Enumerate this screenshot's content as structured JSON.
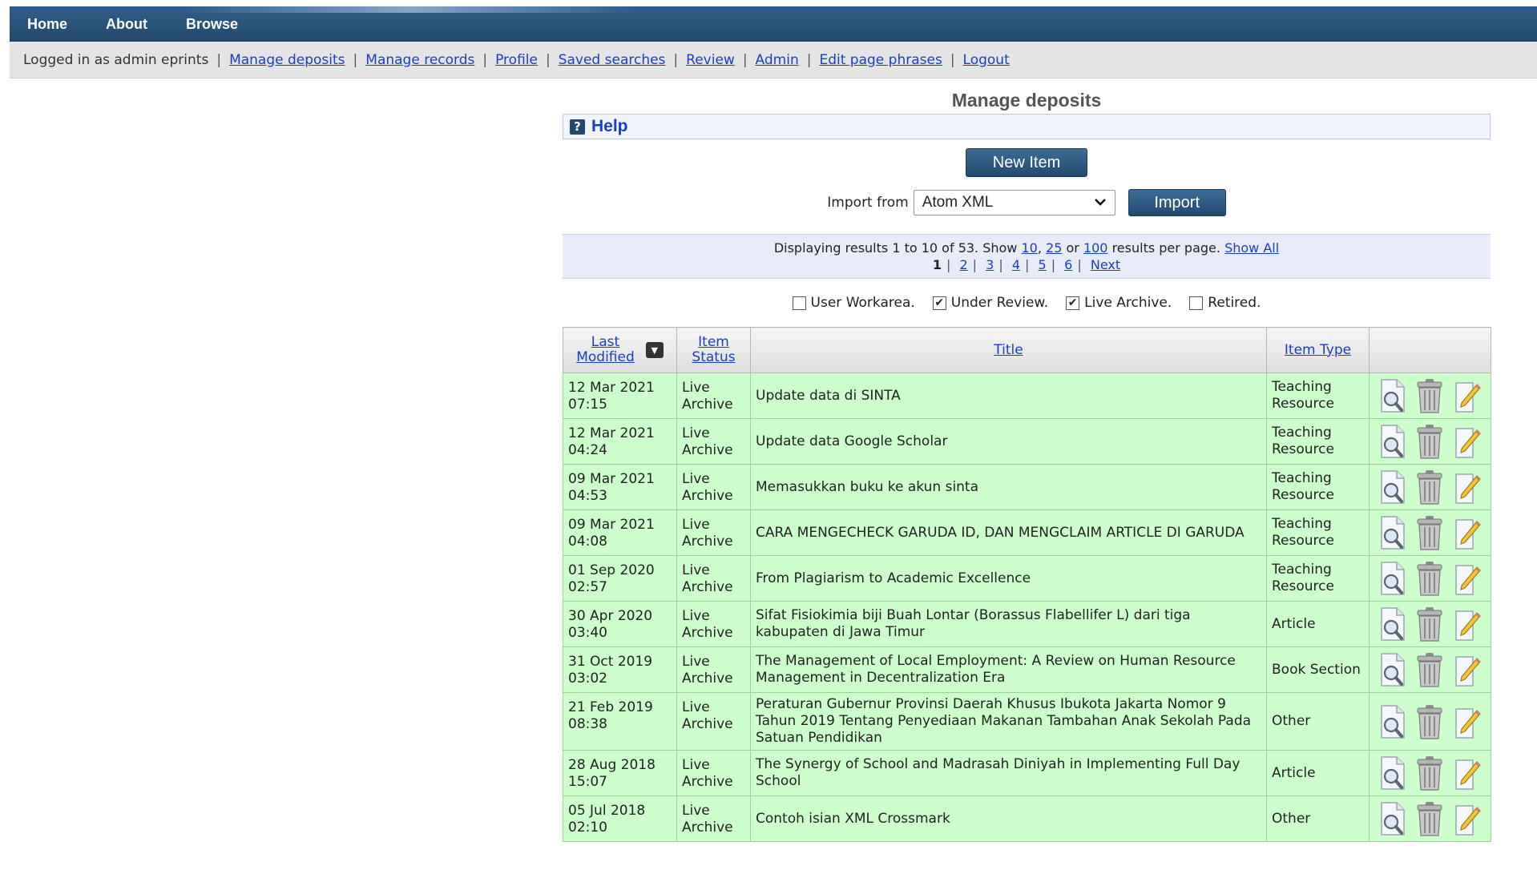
{
  "nav": {
    "home": "Home",
    "about": "About",
    "browse": "Browse"
  },
  "userbar": {
    "logged_in": "Logged in as admin eprints",
    "links": [
      "Manage deposits",
      "Manage records",
      "Profile",
      "Saved searches",
      "Review",
      "Admin",
      "Edit page phrases",
      "Logout"
    ]
  },
  "page": {
    "title": "Manage deposits",
    "help": "Help"
  },
  "actions": {
    "new_item": "New Item",
    "import_from": "Import from",
    "import_format": "Atom XML",
    "import": "Import"
  },
  "results": {
    "text": "Displaying results 1 to 10 of 53. Show",
    "per_page": [
      "10",
      "25",
      "100"
    ],
    "or": "or",
    "results_per_page": "results per page.",
    "show_all": "Show All",
    "current_page": "1",
    "pages": [
      "2",
      "3",
      "4",
      "5",
      "6"
    ],
    "next": "Next"
  },
  "filters": [
    {
      "label": "User Workarea.",
      "checked": false
    },
    {
      "label": "Under Review.",
      "checked": true
    },
    {
      "label": "Live Archive.",
      "checked": true
    },
    {
      "label": "Retired.",
      "checked": false
    }
  ],
  "table": {
    "headers": {
      "modified_line1": "Last",
      "modified_line2": "Modified",
      "status_line1": "Item",
      "status_line2": "Status",
      "title": "Title",
      "type": "Item Type"
    },
    "rows": [
      {
        "date": "12 Mar 2021",
        "time": "07:15",
        "s1": "Live",
        "s2": "Archive",
        "title": "Update data di SINTA",
        "t1": "Teaching",
        "t2": "Resource"
      },
      {
        "date": "12 Mar 2021",
        "time": "04:24",
        "s1": "Live",
        "s2": "Archive",
        "title": "Update data Google Scholar",
        "t1": "Teaching",
        "t2": "Resource"
      },
      {
        "date": "09 Mar 2021",
        "time": "04:53",
        "s1": "Live",
        "s2": "Archive",
        "title": "Memasukkan buku ke akun sinta",
        "t1": "Teaching",
        "t2": "Resource"
      },
      {
        "date": "09 Mar 2021",
        "time": "04:08",
        "s1": "Live",
        "s2": "Archive",
        "title": "CARA MENGECHECK GARUDA ID, DAN MENGCLAIM ARTICLE DI GARUDA",
        "t1": "Teaching",
        "t2": "Resource"
      },
      {
        "date": "01 Sep 2020",
        "time": "02:57",
        "s1": "Live",
        "s2": "Archive",
        "title": "From Plagiarism to Academic Excellence",
        "t1": "Teaching",
        "t2": "Resource"
      },
      {
        "date": "30 Apr 2020",
        "time": "03:40",
        "s1": "Live",
        "s2": "Archive",
        "title": "Sifat Fisiokimia biji Buah Lontar (Borassus Flabellifer L) dari tiga kabupaten di Jawa Timur",
        "t1": "Article",
        "t2": ""
      },
      {
        "date": "31 Oct 2019",
        "time": "03:02",
        "s1": "Live",
        "s2": "Archive",
        "title": "The Management of Local Employment: A Review on Human Resource Management in Decentralization Era",
        "t1": "Book Section",
        "t2": ""
      },
      {
        "date": "21 Feb 2019",
        "time": "08:38",
        "s1": "Live",
        "s2": "Archive",
        "title": "Peraturan Gubernur Provinsi Daerah Khusus Ibukota Jakarta Nomor 9 Tahun 2019 Tentang Penyediaan Makanan Tambahan Anak Sekolah Pada Satuan Pendidikan",
        "t1": "Other",
        "t2": ""
      },
      {
        "date": "28 Aug 2018",
        "time": "15:07",
        "s1": "Live",
        "s2": "Archive",
        "title": "The Synergy of School and Madrasah Diniyah in Implementing Full Day School",
        "t1": "Article",
        "t2": ""
      },
      {
        "date": "05 Jul 2018",
        "time": "02:10",
        "s1": "Live",
        "s2": "Archive",
        "title": "Contoh isian XML Crossmark",
        "t1": "Other",
        "t2": ""
      }
    ]
  },
  "icons": {
    "view": "magnifier-view-icon",
    "delete": "trash-can-icon",
    "edit": "pencil-edit-icon",
    "sort": "sort-desc-icon",
    "help": "question-mark-icon"
  },
  "colors": {
    "nav_bar": "#2a5680",
    "row_live": "#ccffcc",
    "link": "#1a3fc4"
  }
}
